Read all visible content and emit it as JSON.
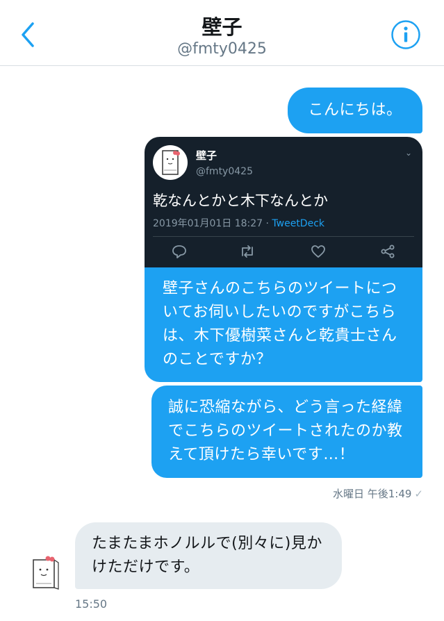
{
  "header": {
    "title": "壁子",
    "handle": "@fmty0425"
  },
  "messages": {
    "greeting": "こんにちは。",
    "quoted_tweet": {
      "name": "壁子",
      "handle": "@fmty0425",
      "text": "乾なんとかと木下なんとか",
      "timestamp": "2019年01月01日 18:27 · ",
      "source": "TweetDeck"
    },
    "question_1": "壁子さんのこちらのツイートについてお伺いしたいのですがこちらは、木下優樹菜さんと乾貴士さんのことですか？",
    "question_2": "誠に恐縮ながら、どう言った経緯でこちらのツイートされたのか教えて頂けたら幸いです…！",
    "sent_status": "水曜日 午後1:49",
    "reply": "たまたまホノルルで(別々に)見かけただけです。",
    "reply_time": "15:50"
  },
  "colors": {
    "accent": "#1da1f2",
    "incoming_bubble": "#e6ecf0",
    "tweet_card_bg": "#15202b"
  },
  "icons": [
    "back-chevron-icon",
    "info-icon",
    "reply-icon",
    "retweet-icon",
    "like-icon",
    "share-icon",
    "check-icon"
  ]
}
